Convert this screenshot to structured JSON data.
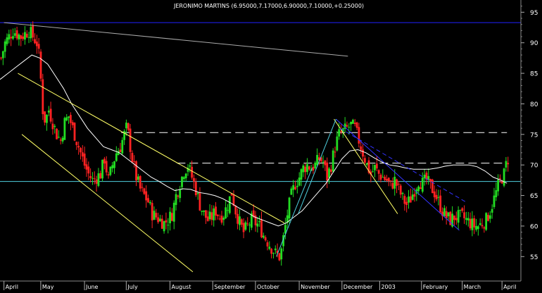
{
  "chart_data": {
    "type": "candlestick",
    "title": "JERONIMO MARTINS (6.95000,7.17000,6.90000,7.10000,+0.25000)",
    "y_ticks": [
      55,
      60,
      65,
      70,
      75,
      80,
      85,
      90,
      95
    ],
    "ylim": [
      51,
      97
    ],
    "x_tick_labels": [
      "April",
      "May",
      "June",
      "July",
      "August",
      "September",
      "October",
      "November",
      "December",
      "2003",
      "February",
      "March",
      "April"
    ],
    "x_tick_positions": [
      2,
      20.5,
      42.5,
      63.5,
      85.5,
      107,
      128.5,
      150.5,
      172,
      191,
      212,
      232.5,
      252.5
    ],
    "xlim": [
      0,
      262
    ],
    "grid": false,
    "series_points": [
      [
        0,
        87.5
      ],
      [
        2,
        90
      ],
      [
        4,
        91
      ],
      [
        6,
        92
      ],
      [
        8,
        91.5
      ],
      [
        10,
        91
      ],
      [
        12,
        91.5
      ],
      [
        14,
        92
      ],
      [
        16,
        91
      ],
      [
        18,
        90
      ],
      [
        19,
        88
      ],
      [
        20,
        84
      ],
      [
        21,
        79
      ],
      [
        22,
        77.5
      ],
      [
        23,
        78
      ],
      [
        24,
        79
      ],
      [
        26,
        77
      ],
      [
        28,
        75
      ],
      [
        30,
        74
      ],
      [
        32,
        77
      ],
      [
        34,
        78
      ],
      [
        36,
        76
      ],
      [
        38,
        74
      ],
      [
        40,
        72
      ],
      [
        42,
        70
      ],
      [
        44,
        68.5
      ],
      [
        46,
        67.5
      ],
      [
        48,
        68
      ],
      [
        50,
        68.5
      ],
      [
        52,
        71
      ],
      [
        54,
        67.5
      ],
      [
        56,
        70
      ],
      [
        58,
        72
      ],
      [
        60,
        73
      ],
      [
        62,
        75
      ],
      [
        63,
        76
      ],
      [
        64,
        75
      ],
      [
        65,
        73
      ],
      [
        66,
        71
      ],
      [
        68,
        68
      ],
      [
        70,
        66
      ],
      [
        72,
        65
      ],
      [
        74,
        64
      ],
      [
        76,
        62
      ],
      [
        78,
        61.5
      ],
      [
        80,
        61
      ],
      [
        82,
        60.5
      ],
      [
        84,
        61
      ],
      [
        86,
        62
      ],
      [
        88,
        65
      ],
      [
        90,
        67
      ],
      [
        92,
        69
      ],
      [
        94,
        70
      ],
      [
        96,
        68
      ],
      [
        98,
        66
      ],
      [
        100,
        63.5
      ],
      [
        102,
        62
      ],
      [
        104,
        61
      ],
      [
        106,
        61.5
      ],
      [
        108,
        62.5
      ],
      [
        110,
        61.5
      ],
      [
        112,
        62
      ],
      [
        114,
        63.5
      ],
      [
        116,
        65.5
      ],
      [
        118,
        62.5
      ],
      [
        120,
        60.5
      ],
      [
        122,
        59
      ],
      [
        124,
        60
      ],
      [
        126,
        61
      ],
      [
        128,
        60.5
      ],
      [
        130,
        60
      ],
      [
        132,
        58.5
      ],
      [
        134,
        57.5
      ],
      [
        136,
        56.5
      ],
      [
        138,
        55.5
      ],
      [
        140,
        55
      ],
      [
        141,
        56
      ],
      [
        142,
        58
      ],
      [
        144,
        62
      ],
      [
        146,
        65
      ],
      [
        148,
        67
      ],
      [
        150,
        68
      ],
      [
        152,
        69.5
      ],
      [
        154,
        70
      ],
      [
        156,
        69.5
      ],
      [
        158,
        70
      ],
      [
        160,
        71
      ],
      [
        162,
        70.5
      ],
      [
        164,
        68
      ],
      [
        166,
        70
      ],
      [
        168,
        73
      ],
      [
        170,
        75
      ],
      [
        172,
        75.5
      ],
      [
        174,
        76
      ],
      [
        176,
        76.5
      ],
      [
        178,
        76
      ],
      [
        180,
        74
      ],
      [
        182,
        72
      ],
      [
        184,
        70
      ],
      [
        186,
        68.5
      ],
      [
        188,
        69.5
      ],
      [
        190,
        68.5
      ],
      [
        192,
        68
      ],
      [
        194,
        67.5
      ],
      [
        196,
        66.5
      ],
      [
        198,
        67.5
      ],
      [
        200,
        66
      ],
      [
        202,
        64.5
      ],
      [
        204,
        63.5
      ],
      [
        206,
        64.5
      ],
      [
        208,
        66
      ],
      [
        210,
        67.5
      ],
      [
        212,
        67
      ],
      [
        214,
        67.5
      ],
      [
        216,
        66.5
      ],
      [
        218,
        65.5
      ],
      [
        220,
        64
      ],
      [
        222,
        62.5
      ],
      [
        224,
        61.5
      ],
      [
        226,
        61
      ],
      [
        228,
        61.5
      ],
      [
        230,
        61.5
      ],
      [
        232,
        61.5
      ],
      [
        234,
        61
      ],
      [
        236,
        60.5
      ],
      [
        238,
        60
      ],
      [
        240,
        60
      ],
      [
        242,
        60.5
      ],
      [
        244,
        61
      ],
      [
        246,
        62.5
      ],
      [
        248,
        64.5
      ],
      [
        250,
        66.5
      ],
      [
        252,
        68
      ],
      [
        253,
        68.5
      ],
      [
        254,
        70
      ],
      [
        255,
        71
      ]
    ],
    "moving_average": [
      [
        0,
        84
      ],
      [
        4,
        85
      ],
      [
        8,
        86
      ],
      [
        12,
        87
      ],
      [
        16,
        88
      ],
      [
        20,
        87.5
      ],
      [
        24,
        86.5
      ],
      [
        28,
        84.5
      ],
      [
        32,
        82.5
      ],
      [
        36,
        80
      ],
      [
        40,
        78
      ],
      [
        44,
        76
      ],
      [
        48,
        74.5
      ],
      [
        52,
        73
      ],
      [
        56,
        72.5
      ],
      [
        60,
        72
      ],
      [
        64,
        71
      ],
      [
        68,
        70
      ],
      [
        72,
        69
      ],
      [
        76,
        68
      ],
      [
        80,
        67.3
      ],
      [
        84,
        66.5
      ],
      [
        88,
        65.8
      ],
      [
        92,
        66.1
      ],
      [
        96,
        66
      ],
      [
        100,
        65.5
      ],
      [
        104,
        65.3
      ],
      [
        108,
        65
      ],
      [
        112,
        64.5
      ],
      [
        116,
        63.8
      ],
      [
        120,
        63
      ],
      [
        124,
        62.3
      ],
      [
        128,
        61.5
      ],
      [
        132,
        61
      ],
      [
        136,
        60.5
      ],
      [
        140,
        60
      ],
      [
        144,
        60.5
      ],
      [
        148,
        61.5
      ],
      [
        152,
        62.5
      ],
      [
        156,
        64
      ],
      [
        160,
        65.5
      ],
      [
        164,
        67
      ],
      [
        168,
        69
      ],
      [
        172,
        71
      ],
      [
        176,
        72.3
      ],
      [
        180,
        72.5
      ],
      [
        184,
        72
      ],
      [
        188,
        71.2
      ],
      [
        192,
        70.5
      ],
      [
        196,
        70
      ],
      [
        200,
        69.8
      ],
      [
        204,
        69.5
      ],
      [
        208,
        69.3
      ],
      [
        212,
        69.3
      ],
      [
        216,
        69.3
      ],
      [
        220,
        69.5
      ],
      [
        224,
        69.8
      ],
      [
        228,
        70
      ],
      [
        232,
        70
      ],
      [
        236,
        70
      ],
      [
        240,
        69.7
      ],
      [
        244,
        69
      ],
      [
        248,
        68
      ],
      [
        252,
        67.5
      ],
      [
        255,
        67
      ]
    ],
    "levels": [
      {
        "name": "top-horizontal",
        "value": 93.3,
        "style": "solid",
        "color": "#2222ff"
      },
      {
        "name": "support-horizontal",
        "value": 67.3,
        "style": "solid",
        "color": "#4fd0e0"
      }
    ],
    "dashed_levels": [
      {
        "value": 75.3,
        "from": 61,
        "to": 255,
        "color": "#ffffff"
      },
      {
        "value": 70.3,
        "from": 89,
        "to": 255,
        "color": "#ffffff"
      }
    ],
    "trendlines": [
      {
        "name": "long-term-down",
        "points": [
          [
            2,
            93.3
          ],
          [
            175,
            87.8
          ]
        ],
        "color": "#aaaaaa"
      },
      {
        "name": "channel-upper",
        "points": [
          [
            9,
            85
          ],
          [
            143,
            60.5
          ]
        ],
        "color": "#ffff66"
      },
      {
        "name": "channel-lower",
        "points": [
          [
            11,
            75
          ],
          [
            97,
            52.5
          ]
        ],
        "color": "#ffff66"
      },
      {
        "name": "short-down-yellow",
        "points": [
          [
            168,
            77.5
          ],
          [
            200,
            62
          ]
        ],
        "color": "#ffff66"
      },
      {
        "name": "blue-down-solid",
        "points": [
          [
            169,
            77.5
          ],
          [
            231,
            59.3
          ]
        ],
        "color": "#3333ff"
      },
      {
        "name": "blue-down-dashed",
        "points": [
          [
            171,
            76
          ],
          [
            234,
            64
          ]
        ],
        "color": "#3333ff"
      },
      {
        "name": "cyan-up-1",
        "points": [
          [
            139,
            55
          ],
          [
            157,
            69.5
          ]
        ],
        "color": "#4fd0e0"
      },
      {
        "name": "cyan-up-2",
        "points": [
          [
            150,
            62
          ],
          [
            169,
            77.5
          ]
        ],
        "color": "#4fd0e0"
      }
    ]
  }
}
